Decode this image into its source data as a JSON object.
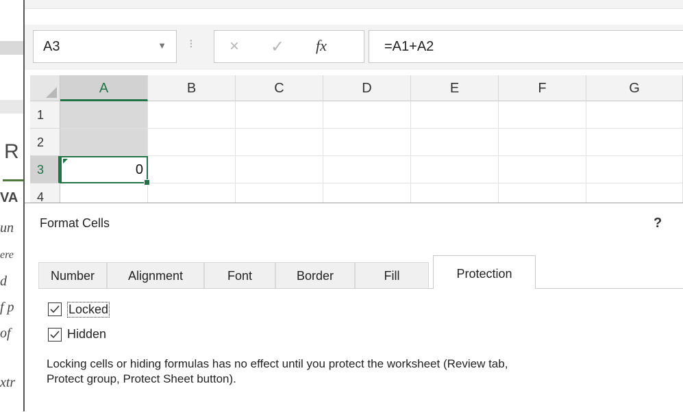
{
  "background_doc": {
    "fragments": [
      "R",
      "VA",
      "un",
      "ere",
      "d",
      "f p",
      "of",
      "xtr"
    ]
  },
  "formula_bar": {
    "name_box": "A3",
    "name_dropdown_icon": "chevron-down",
    "separator": "⁝",
    "cancel_icon": "×",
    "enter_icon": "✓",
    "fx_label": "fx",
    "formula": "=A1+A2"
  },
  "sheet": {
    "columns": [
      "A",
      "B",
      "C",
      "D",
      "E",
      "F",
      "G"
    ],
    "rows": [
      "1",
      "2",
      "3",
      "4"
    ],
    "active_cell": "A3",
    "cells": [
      {
        "row": "1",
        "col": "A",
        "value": "",
        "shaded": true
      },
      {
        "row": "2",
        "col": "A",
        "value": "",
        "shaded": true
      },
      {
        "row": "3",
        "col": "A",
        "value": "0",
        "shaded": false
      }
    ]
  },
  "dialog": {
    "title": "Format Cells",
    "help": "?",
    "tabs": [
      "Number",
      "Alignment",
      "Font",
      "Border",
      "Fill",
      "Protection"
    ],
    "active_tab": "Protection",
    "locked": {
      "label": "Locked",
      "checked": true
    },
    "hidden": {
      "label": "Hidden",
      "checked": true
    },
    "help_text_1": "Locking cells or hiding formulas has no effect until you protect the worksheet (Review tab,",
    "help_text_2": "Protect group, Protect Sheet button)."
  },
  "colors": {
    "excel_green": "#217346",
    "selected_header": "#d2d2d2",
    "shaded_cell": "#d9d9d9"
  }
}
